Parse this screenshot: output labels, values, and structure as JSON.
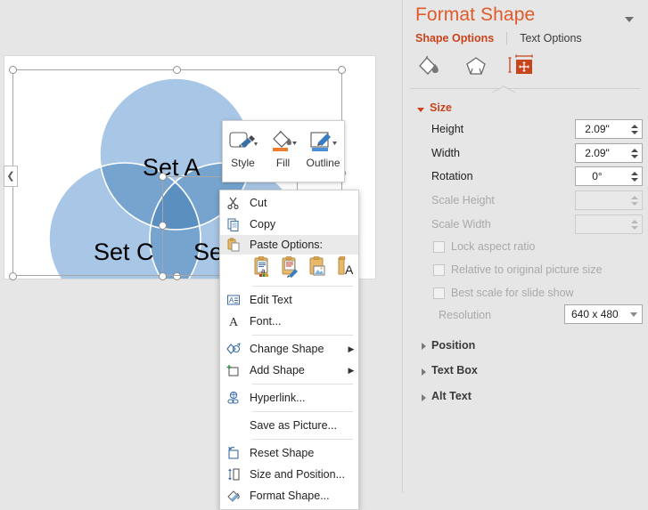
{
  "slide": {
    "venn": {
      "labels": [
        "Set A",
        "Set B",
        "Set C"
      ],
      "circle_fill": "#a8c6e5",
      "circle_overlap": "#6f9fcb",
      "circle_stroke": "#ffffff"
    }
  },
  "mini_toolbar": {
    "items": [
      {
        "label": "Style",
        "icon": "shape-style-icon"
      },
      {
        "label": "Fill",
        "icon": "fill-bucket-icon",
        "swatch": "#ed7d31"
      },
      {
        "label": "Outline",
        "icon": "outline-pencil-icon",
        "swatch": "#4a90d9"
      }
    ]
  },
  "context_menu": {
    "items": [
      {
        "label": "Cut",
        "accel": "t",
        "icon": "scissors-icon",
        "type": "item"
      },
      {
        "label": "Copy",
        "accel": "C",
        "icon": "copy-icon",
        "type": "item"
      },
      {
        "label": "Paste Options:",
        "icon": "clipboard-icon",
        "type": "paste-header"
      },
      {
        "type": "paste-row",
        "options": [
          {
            "name": "paste-keep-source-formatting-icon"
          },
          {
            "name": "paste-keep-text-only-brush-icon"
          },
          {
            "name": "paste-picture-icon"
          },
          {
            "name": "paste-text-only-icon"
          }
        ]
      },
      {
        "type": "separator"
      },
      {
        "label": "Edit Text",
        "accel": "x",
        "icon": "edit-text-icon",
        "type": "item"
      },
      {
        "label": "Font...",
        "accel": "F",
        "icon": "font-a-icon",
        "type": "item"
      },
      {
        "type": "separator"
      },
      {
        "label": "Change Shape",
        "accel": "g",
        "icon": "change-shape-icon",
        "type": "item",
        "submenu": true
      },
      {
        "label": "Add Shape",
        "accel": "A",
        "icon": "add-shape-icon",
        "type": "item",
        "submenu": true
      },
      {
        "type": "separator"
      },
      {
        "label": "Hyperlink...",
        "accel": "H",
        "icon": "hyperlink-icon",
        "type": "item"
      },
      {
        "type": "separator"
      },
      {
        "label": "Save as Picture...",
        "accel": "S",
        "icon": "none",
        "type": "item"
      },
      {
        "type": "separator"
      },
      {
        "label": "Reset Shape",
        "accel": "e",
        "icon": "reset-shape-icon",
        "type": "item"
      },
      {
        "label": "Size and Position...",
        "accel": "z",
        "icon": "size-position-icon",
        "type": "item"
      },
      {
        "label": "Format Shape...",
        "accel": "o",
        "icon": "format-shape-icon",
        "type": "item"
      }
    ]
  },
  "pane": {
    "title": "Format Shape",
    "dropdown_icon": "chevron-down-icon",
    "tabs": [
      {
        "label": "Shape Options",
        "active": true
      },
      {
        "label": "Text Options",
        "active": false
      }
    ],
    "icon_tabs": [
      {
        "name": "fill-and-line-icon",
        "selected": false
      },
      {
        "name": "effects-icon",
        "selected": false
      },
      {
        "name": "size-and-properties-icon",
        "selected": true
      }
    ],
    "accent_color": "#c9431b",
    "sections": [
      {
        "label": "Size",
        "expanded": true
      },
      {
        "label": "Position",
        "expanded": false
      },
      {
        "label": "Text Box",
        "expanded": false
      },
      {
        "label": "Alt Text",
        "expanded": false
      }
    ],
    "size_fields": [
      {
        "label": "Height",
        "accel": "e",
        "value": "2.09\"",
        "disabled": false
      },
      {
        "label": "Width",
        "accel": "d",
        "value": "2.09\"",
        "disabled": false
      },
      {
        "label": "Rotation",
        "accel": "t",
        "value": "0°",
        "disabled": false
      },
      {
        "label": "Scale Height",
        "accel": "H",
        "value": "",
        "disabled": true
      },
      {
        "label": "Scale Width",
        "accel": "W",
        "value": "",
        "disabled": true
      }
    ],
    "checkboxes": [
      {
        "label": "Lock aspect ratio",
        "accel": "a",
        "checked": false,
        "disabled": true
      },
      {
        "label": "Relative to original picture size",
        "accel": "R",
        "checked": false,
        "disabled": true
      },
      {
        "label": "Best scale for slide show",
        "accel": "B",
        "checked": false,
        "disabled": true
      }
    ],
    "resolution": {
      "label": "Resolution",
      "accel": "o",
      "value": "640 x 480",
      "disabled": true
    }
  }
}
